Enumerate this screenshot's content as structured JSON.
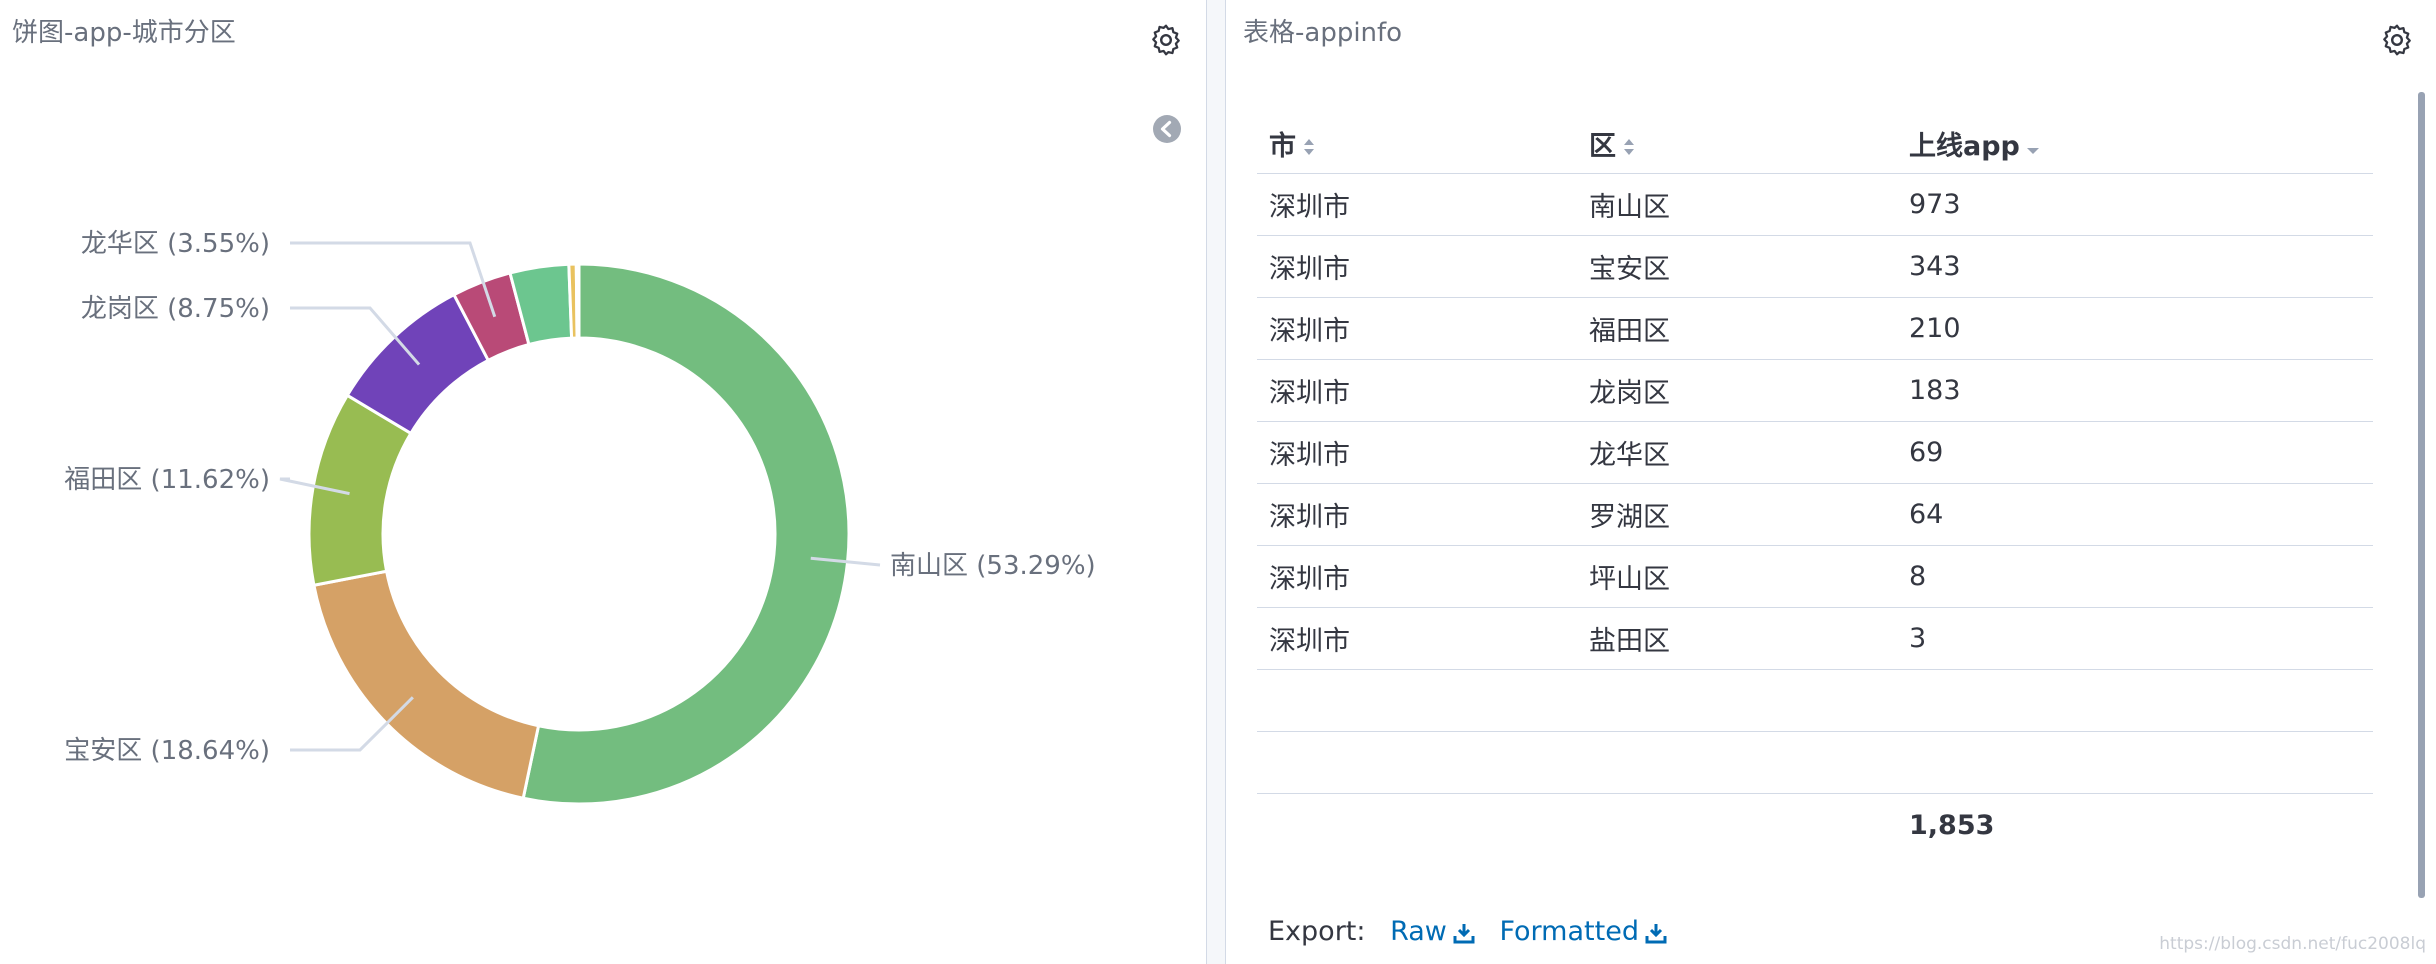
{
  "pie_panel": {
    "title": "饼图-app-城市分区",
    "icons": {
      "settings": "gear-icon",
      "collapse": "chevron-left-circle-icon"
    }
  },
  "chart_data": {
    "type": "pie",
    "donut": true,
    "slices": [
      {
        "label": "南山区",
        "percent": 53.29,
        "label_text": "南山区 (53.29%)",
        "color": "#73bd7f"
      },
      {
        "label": "宝安区",
        "percent": 18.64,
        "label_text": "宝安区 (18.64%)",
        "color": "#d5a166"
      },
      {
        "label": "福田区",
        "percent": 11.62,
        "label_text": "福田区 (11.62%)",
        "color": "#98bc52"
      },
      {
        "label": "龙岗区",
        "percent": 8.75,
        "label_text": "龙岗区 (8.75%)",
        "color": "#7043b9"
      },
      {
        "label": "龙华区",
        "percent": 3.55,
        "label_text": "龙华区 (3.55%)",
        "color": "#b94a77"
      },
      {
        "label": "罗湖区",
        "percent": 3.51,
        "label_text": "",
        "color": "#6cc68f"
      },
      {
        "label": "坪山区",
        "percent": 0.44,
        "label_text": "",
        "color": "#e9c25f"
      },
      {
        "label": "盐田区",
        "percent": 0.16,
        "label_text": "",
        "color": "#5a9ad6"
      }
    ]
  },
  "table_panel": {
    "title": "表格-appinfo",
    "columns": [
      "市",
      "区",
      "上线app"
    ],
    "rows": [
      [
        "深圳市",
        "南山区",
        "973"
      ],
      [
        "深圳市",
        "宝安区",
        "343"
      ],
      [
        "深圳市",
        "福田区",
        "210"
      ],
      [
        "深圳市",
        "龙岗区",
        "183"
      ],
      [
        "深圳市",
        "龙华区",
        "69"
      ],
      [
        "深圳市",
        "罗湖区",
        "64"
      ],
      [
        "深圳市",
        "坪山区",
        "8"
      ],
      [
        "深圳市",
        "盐田区",
        "3"
      ]
    ],
    "total": "1,853",
    "export_label": "Export:",
    "export_raw": "Raw",
    "export_formatted": "Formatted",
    "accent": "#006bb4"
  },
  "watermark": "https://blog.csdn.net/fuc2008lq"
}
